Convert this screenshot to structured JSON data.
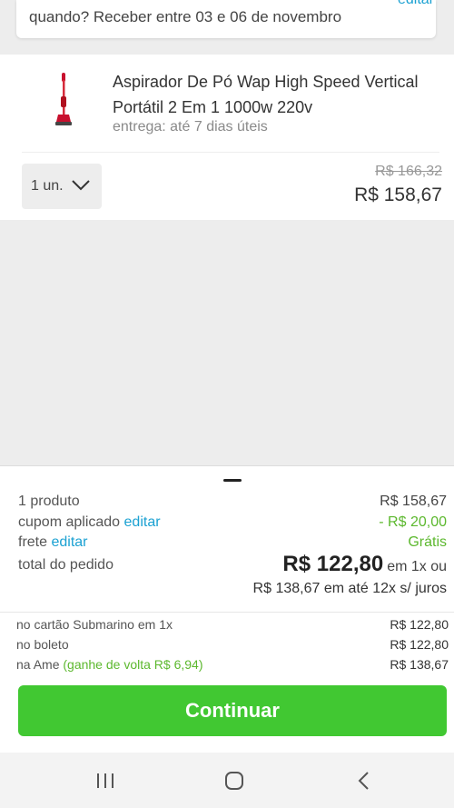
{
  "delivery": {
    "edit_label": "editar",
    "text": "quando? Receber entre 03 e 06 de novembro"
  },
  "product": {
    "name": "Aspirador De Pó Wap High Speed Vertical Portátil 2 Em 1 1000w 220v",
    "delivery": "entrega: até 7 dias úteis",
    "quantity": "1 un.",
    "old_price": "R$ 166,32",
    "price": "R$ 158,67"
  },
  "summary": {
    "products_label": "1 produto",
    "products_value": "R$ 158,67",
    "coupon_label": "cupom aplicado",
    "coupon_edit": "editar",
    "coupon_value": "- R$ 20,00",
    "shipping_label": "frete",
    "shipping_edit": "editar",
    "shipping_value": "Grátis",
    "total_label": "total do pedido",
    "total_value": "R$ 122,80",
    "total_suffix": "em 1x ou",
    "installments": "R$ 138,67 em até 12x s/ juros"
  },
  "payment_options": [
    {
      "label": "no cartão Submarino em 1x",
      "value": "R$ 122,80"
    },
    {
      "label": "no boleto",
      "value": "R$ 122,80"
    },
    {
      "label": "na Ame",
      "cashback": "(ganhe de volta R$ 6,94)",
      "value": "R$ 138,67"
    }
  ],
  "continue_label": "Continuar",
  "colors": {
    "accent_link": "#1ba1d2",
    "discount_green": "#5cb82e",
    "button_green": "#41c832"
  },
  "nav_icons": [
    "recent-apps-icon",
    "home-icon",
    "back-icon"
  ]
}
